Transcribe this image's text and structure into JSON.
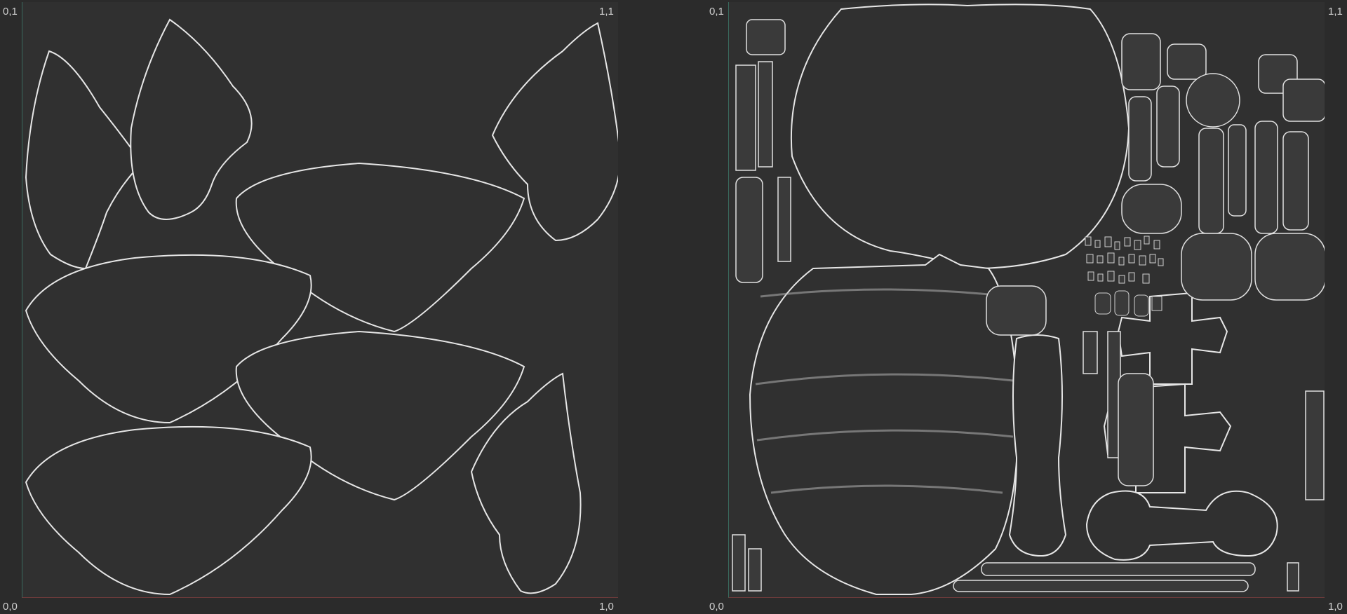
{
  "left_viewport": {
    "labels": {
      "top_left": "0,1",
      "top_right": "1,1",
      "bottom_left": "0,0",
      "bottom_right": "1,0"
    },
    "colors": {
      "background": "#2b2b2b",
      "uv_square": "#303030",
      "wire": "#e6e6e6"
    }
  },
  "right_viewport": {
    "labels": {
      "top_left": "0,1",
      "top_right": "1,1",
      "bottom_left": "0,0",
      "bottom_right": "1,0"
    },
    "colors": {
      "background": "#2b2b2b",
      "uv_square": "#303030",
      "wire": "#e6e6e6"
    }
  }
}
